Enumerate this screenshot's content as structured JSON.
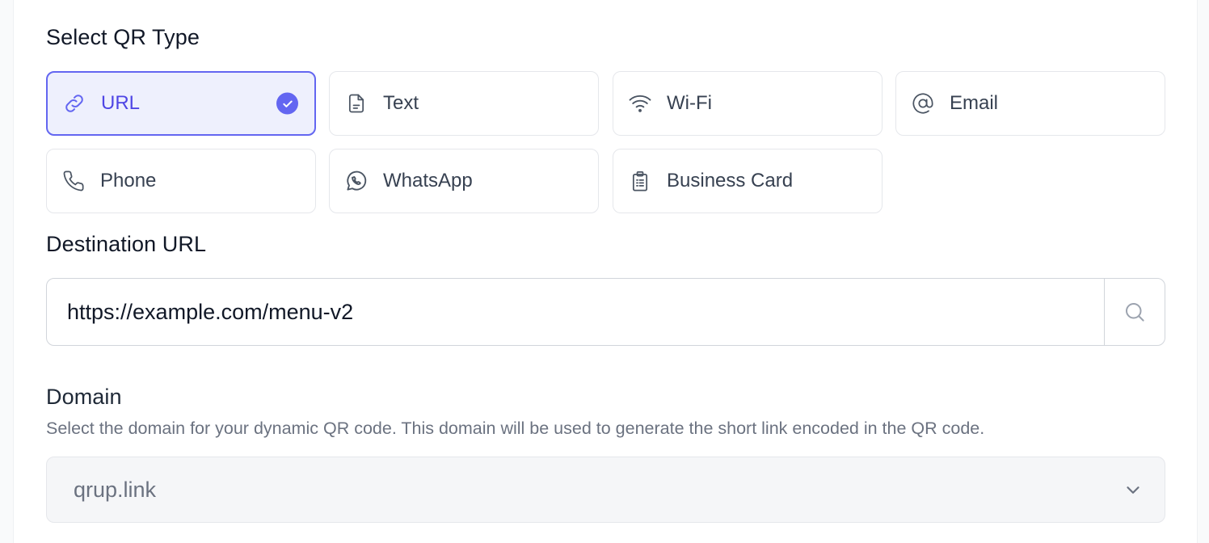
{
  "qr_type": {
    "heading": "Select QR Type",
    "options": [
      {
        "label": "URL",
        "icon": "link-icon",
        "selected": true
      },
      {
        "label": "Text",
        "icon": "document-icon",
        "selected": false
      },
      {
        "label": "Wi-Fi",
        "icon": "wifi-icon",
        "selected": false
      },
      {
        "label": "Email",
        "icon": "at-icon",
        "selected": false
      },
      {
        "label": "Phone",
        "icon": "phone-icon",
        "selected": false
      },
      {
        "label": "WhatsApp",
        "icon": "whatsapp-icon",
        "selected": false
      },
      {
        "label": "Business Card",
        "icon": "clipboard-icon",
        "selected": false
      }
    ]
  },
  "destination": {
    "heading": "Destination URL",
    "value": "https://example.com/menu-v2",
    "button_icon": "search-icon"
  },
  "domain": {
    "heading": "Domain",
    "help": "Select the domain for your dynamic QR code. This domain will be used to generate the short link encoded in the QR code.",
    "selected": "qrup.link",
    "chevron_icon": "chevron-down-icon"
  },
  "colors": {
    "accent": "#6366f1",
    "selected_bg": "#eef0fd",
    "border": "#e5e7eb"
  }
}
